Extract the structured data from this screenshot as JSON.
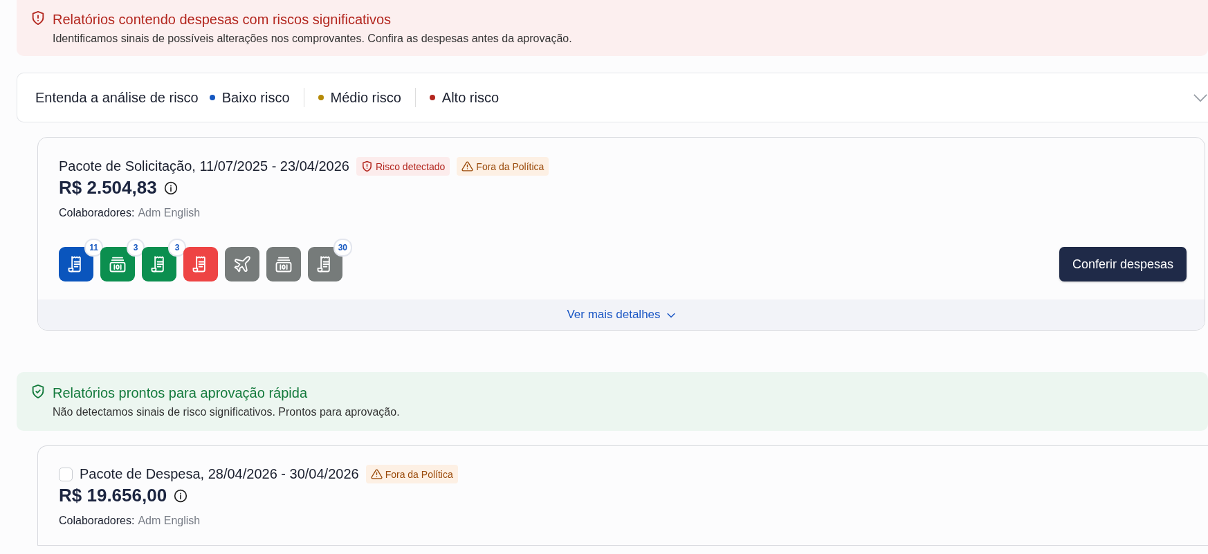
{
  "risk_alert": {
    "kind": "risk",
    "title": "Relatórios contendo despesas com riscos significativos",
    "message": "Identificamos sinais de possíveis alterações nos comprovantes. Confira as despesas antes da aprovação."
  },
  "risk_legend": {
    "title": "Entenda a análise de risco",
    "expanded": false,
    "levels": [
      {
        "label": "Baixo risco",
        "color": "#1557c0"
      },
      {
        "label": "Médio risco",
        "color": "#b58a07"
      },
      {
        "label": "Alto risco",
        "color": "#b3261e"
      }
    ]
  },
  "risk_reports": [
    {
      "title": "Pacote de Solicitação, 11/07/2025 - 23/04/2026",
      "tags": [
        {
          "kind": "risk",
          "label": "Risco detectado"
        },
        {
          "kind": "policy",
          "label": "Fora da Política"
        }
      ],
      "amount": "R$ 2.504,83",
      "collaborators_label": "Colaboradores:",
      "collaborators": "Adm English",
      "expenses": [
        {
          "kind": "receipt",
          "color": "#0a55bd",
          "count": "11"
        },
        {
          "kind": "cash",
          "color": "#0b8f4f",
          "count": "3"
        },
        {
          "kind": "receipt",
          "color": "#0b8f4f",
          "count": "3"
        },
        {
          "kind": "receipt",
          "color": "#ee4444"
        },
        {
          "kind": "plane",
          "color": "#767b7a"
        },
        {
          "kind": "cash",
          "color": "#767b7a"
        },
        {
          "kind": "receipt",
          "color": "#767b7a",
          "count": "30"
        }
      ],
      "action": "Conferir despesas",
      "details_link": "Ver mais detalhes"
    }
  ],
  "safe_alert": {
    "kind": "safe",
    "title": "Relatórios prontos para aprovação rápida",
    "message": "Não detectamos sinais de risco significativos. Prontos para aprovação."
  },
  "safe_reports": [
    {
      "checked": false,
      "title": "Pacote de Despesa, 28/04/2026 - 30/04/2026",
      "tags": [
        {
          "kind": "policy",
          "label": "Fora da Política"
        }
      ],
      "amount": "R$ 19.656,00",
      "collaborators_label": "Colaboradores:",
      "collaborators": "Adm English"
    }
  ]
}
